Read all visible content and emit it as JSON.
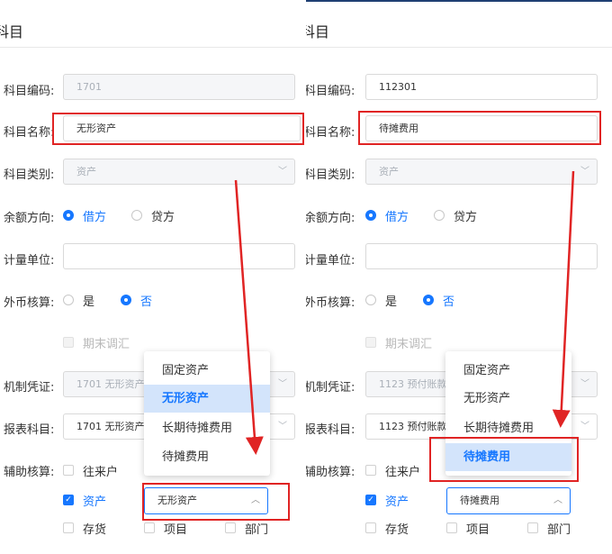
{
  "left": {
    "title": "科目",
    "labels": {
      "code": "科目编码:",
      "name": "科目名称:",
      "category": "科目类别:",
      "direction": "余额方向:",
      "unit": "计量单位:",
      "foreign": "外币核算:",
      "voucher": "机制凭证:",
      "report": "报表科目:",
      "aux": "辅助核算:"
    },
    "code_value": "1701",
    "name_value": "无形资产",
    "category_value": "资产",
    "direction": {
      "debit": "借方",
      "credit": "贷方",
      "selected": "借方"
    },
    "foreign": {
      "yes": "是",
      "no": "否",
      "selected": "否"
    },
    "period_end": "期末调汇",
    "voucher_value": "1701 无形资产",
    "report_value": "1701  无形资产",
    "aux": {
      "customer": "往来户",
      "asset": "资产",
      "inventory": "存货",
      "project": "项目",
      "dept": "部门"
    },
    "asset_select_value": "无形资产",
    "dropdown": [
      "固定资产",
      "无形资产",
      "长期待摊费用",
      "待摊费用"
    ],
    "dropdown_selected": "无形资产"
  },
  "right": {
    "title": "科目",
    "labels": {
      "code": "科目编码:",
      "name": "科目名称:",
      "category": "科目类别:",
      "direction": "余额方向:",
      "unit": "计量单位:",
      "foreign": "外币核算:",
      "voucher": "机制凭证:",
      "report": "报表科目:",
      "aux": "辅助核算:"
    },
    "code_value": "112301",
    "name_value": "待摊费用",
    "category_value": "资产",
    "direction": {
      "debit": "借方",
      "credit": "贷方",
      "selected": "借方"
    },
    "foreign": {
      "yes": "是",
      "no": "否",
      "selected": "否"
    },
    "period_end": "期末调汇",
    "voucher_value": "1123 预付账款",
    "report_value": "1123  预付账款",
    "aux": {
      "customer": "往来户",
      "asset": "资产",
      "inventory": "存货",
      "project": "项目",
      "dept": "部门"
    },
    "asset_select_value": "待摊费用",
    "dropdown": [
      "固定资产",
      "无形资产",
      "长期待摊费用",
      "待摊费用"
    ],
    "dropdown_selected": "待摊费用"
  },
  "colors": {
    "accent": "#1677ff",
    "annotation": "#e02424",
    "dropdown_selected_bg": "#d3e4fb"
  }
}
